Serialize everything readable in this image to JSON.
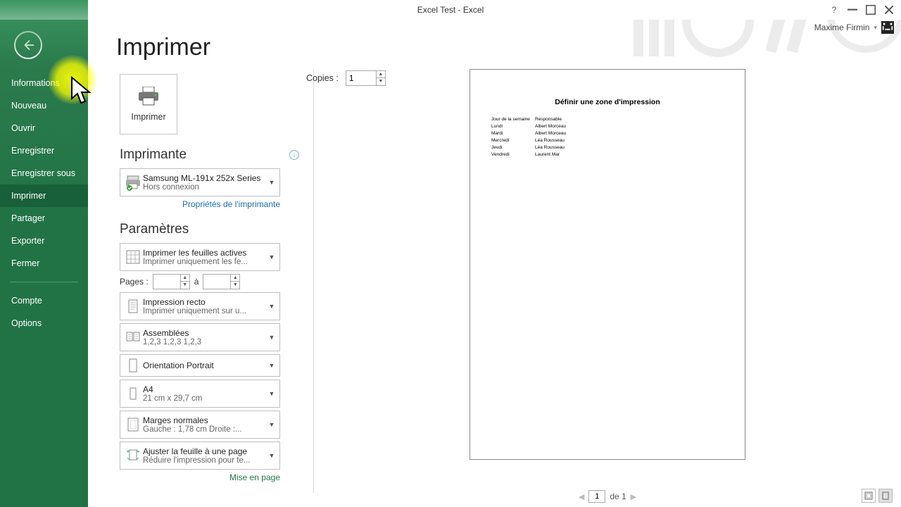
{
  "title": "Excel Test - Excel",
  "user_name": "Maxime Firmin",
  "sidebar": {
    "items": [
      {
        "label": "Informations"
      },
      {
        "label": "Nouveau"
      },
      {
        "label": "Ouvrir"
      },
      {
        "label": "Enregistrer"
      },
      {
        "label": "Enregistrer sous"
      },
      {
        "label": "Imprimer"
      },
      {
        "label": "Partager"
      },
      {
        "label": "Exporter"
      },
      {
        "label": "Fermer"
      }
    ],
    "account": "Compte",
    "options": "Options"
  },
  "page": {
    "title": "Imprimer",
    "print_button": "Imprimer",
    "copies_label": "Copies :",
    "copies_value": "1",
    "printer_heading": "Imprimante",
    "printer_name": "Samsung ML-191x 252x Series",
    "printer_status": "Hors connexion",
    "printer_props": "Propriétés de l'imprimante",
    "settings_heading": "Paramètres",
    "print_active": {
      "l1": "Imprimer les feuilles actives",
      "l2": "Imprimer uniquement les fe..."
    },
    "pages_label": "Pages :",
    "pages_to": "à",
    "duplex": {
      "l1": "Impression recto",
      "l2": "Imprimer uniquement sur u..."
    },
    "collate": {
      "l1": "Assemblées",
      "l2": "1,2,3    1,2,3    1,2,3"
    },
    "orientation": "Orientation Portrait",
    "paper": {
      "l1": "A4",
      "l2": "21 cm x 29,7 cm"
    },
    "margins": {
      "l1": "Marges normales",
      "l2": "Gauche :   1,78 cm    Droite :..."
    },
    "fit": {
      "l1": "Ajuster la feuille à une page",
      "l2": "Réduire l'impression pour te..."
    },
    "page_setup": "Mise en page"
  },
  "preview": {
    "title": "Définir une zone d'impression",
    "rows": [
      {
        "c1": "Jour de la semaine",
        "c2": "Responsable"
      },
      {
        "c1": "Lundi",
        "c2": "Albert Morceau"
      },
      {
        "c1": "Mardi",
        "c2": "Albert Morceau"
      },
      {
        "c1": "Mercredi",
        "c2": "Léa Rousseau"
      },
      {
        "c1": "Jeudi",
        "c2": "Léa Rousseau"
      },
      {
        "c1": "Vendredi",
        "c2": "Laurent Mar"
      }
    ],
    "page_current": "1",
    "page_total": "de 1"
  }
}
